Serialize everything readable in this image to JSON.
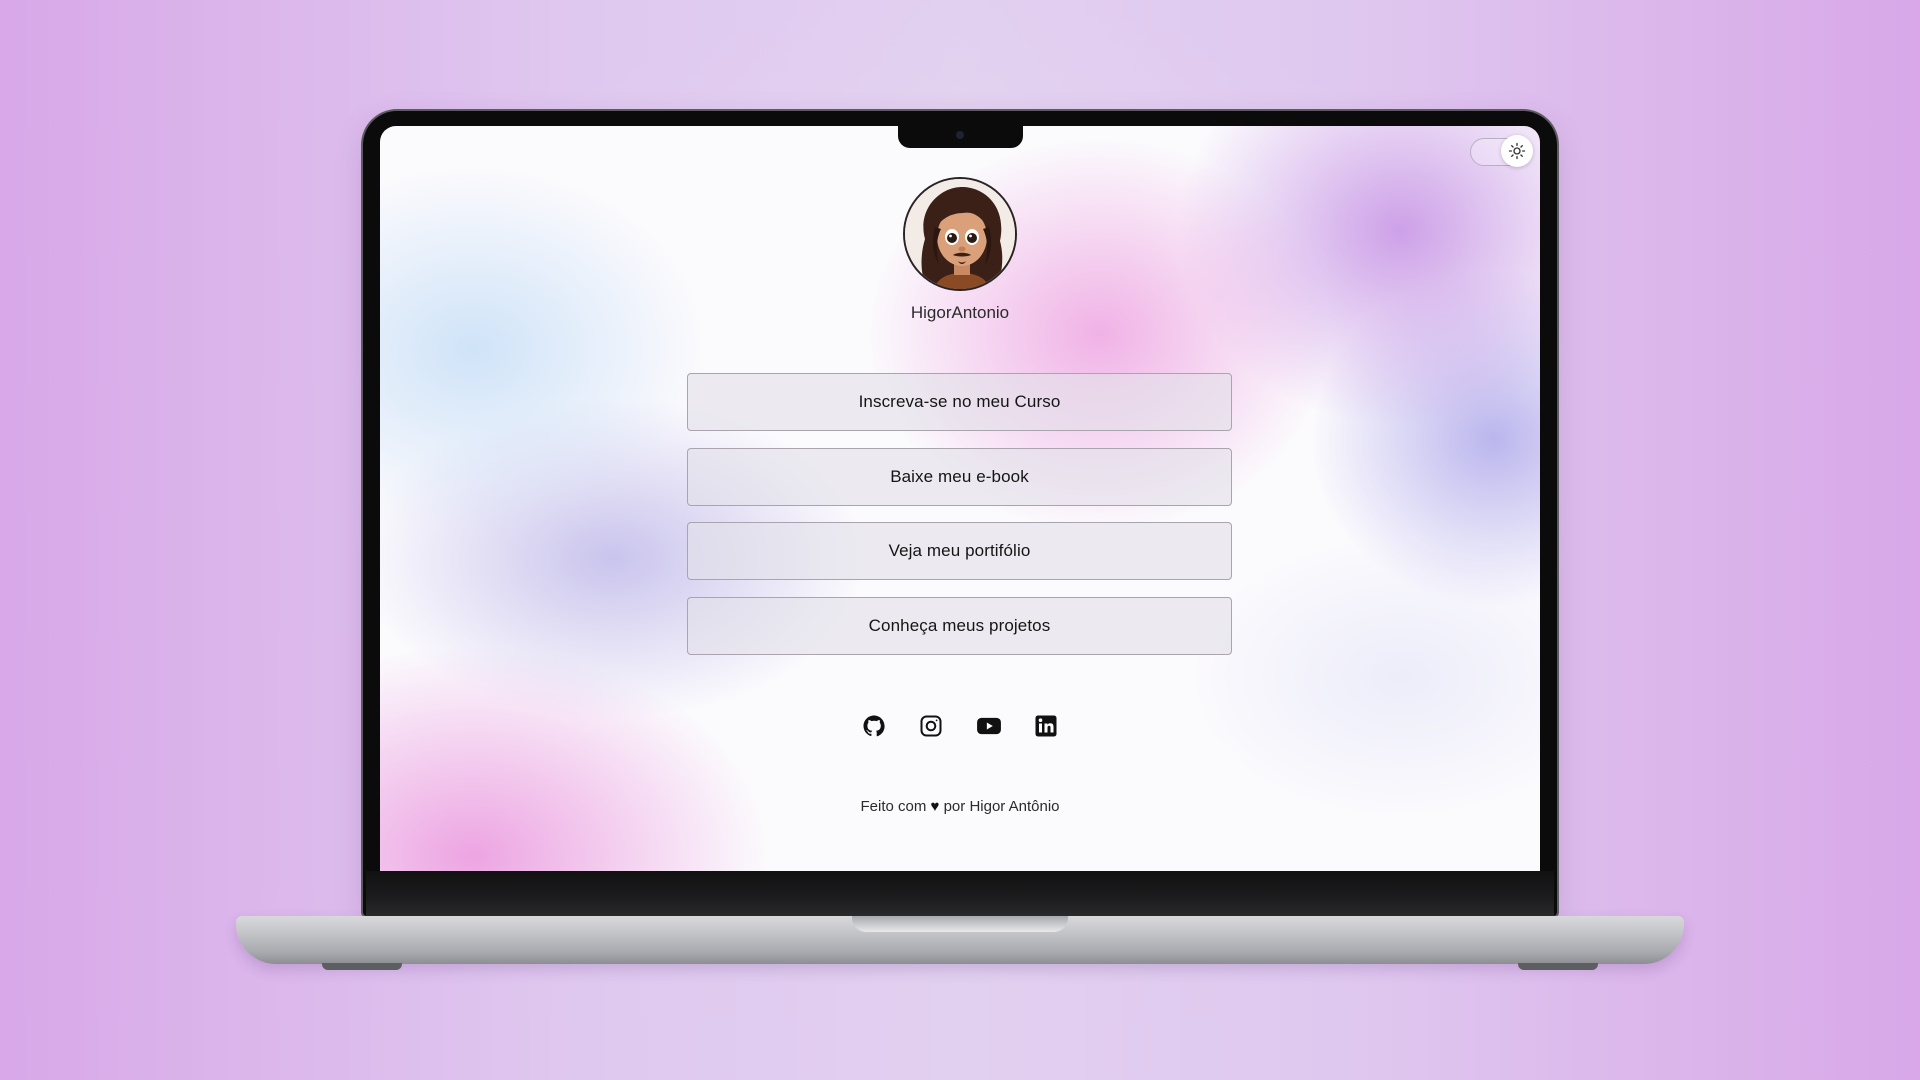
{
  "profile": {
    "username": "HigorAntonio"
  },
  "links": [
    {
      "label": "Inscreva-se no meu Curso"
    },
    {
      "label": "Baixe meu e-book"
    },
    {
      "label": "Veja meu portifólio"
    },
    {
      "label": "Conheça meus projetos"
    }
  ],
  "socials": [
    {
      "icon": "github-icon"
    },
    {
      "icon": "instagram-icon"
    },
    {
      "icon": "youtube-icon"
    },
    {
      "icon": "linkedin-icon"
    }
  ],
  "footer": {
    "prefix": "Feito com",
    "heart": "♥",
    "suffix": "por Higor Antônio"
  },
  "theme_toggle": {
    "icon": "sun-icon"
  },
  "colors": {
    "background": "#e0c6ef",
    "accent_pink": "#ec96dd",
    "accent_purple": "#c591e4",
    "button_fill": "#e2e0e8",
    "text": "#151515"
  }
}
